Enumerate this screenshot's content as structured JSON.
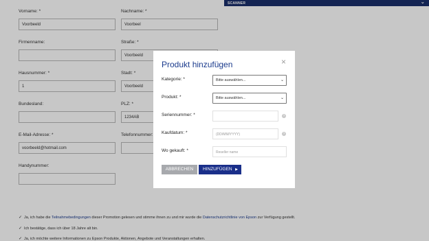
{
  "header": {
    "section_title": "SCANNER"
  },
  "form": {
    "vorname_label": "Vorname: *",
    "vorname_value": "Voorbeeld",
    "nachname_label": "Nachname: *",
    "nachname_value": "Voorbeel",
    "firmenname_label": "Firmenname:",
    "firmenname_value": "",
    "strasse_label": "Straße: *",
    "strasse_value": "Voorbeeld",
    "hausnummer_label": "Hausnummer: *",
    "hausnummer_value": "1",
    "stadt_label": "Stadt: *",
    "stadt_value": "Voorbeeld",
    "bundesland_label": "Bundesland:",
    "bundesland_value": "",
    "plz_label": "PLZ: *",
    "plz_value": "1234AB",
    "email_label": "E-Mail-Adresse: *",
    "email_value": "voorbeeld@hotmail.com",
    "telefon_label": "Telefonnummer:",
    "telefon_value": "",
    "handy_label": "Handynummer:",
    "handy_value": ""
  },
  "consent": {
    "item1_pre": "Ja, ich habe die ",
    "item1_link1": "Teilnahmebedingungen",
    "item1_mid": " dieser Promotion gelesen und stimme ihnen zu und mir wurde die ",
    "item1_link2": "Datenschutzrichtlinie von Epson",
    "item1_post": " zur Verfügung gestellt.",
    "item2": "Ich bestätige, dass ich über 18 Jahre alt bin.",
    "item3": "Ja, ich möchte weitere Informationen zu Epson Produkte, Aktionen, Angebote und Veranstaltungen erhalten."
  },
  "modal": {
    "title": "Produkt hinzufügen",
    "close_glyph": "×",
    "kategorie_label": "Kategorie: *",
    "kategorie_value": "Bitte auswählen...",
    "produkt_label": "Produkt: *",
    "produkt_value": "Bitte auswählen...",
    "serien_label": "Seriennummer: *",
    "serien_value": "",
    "kaufdatum_label": "Kaufdatum: *",
    "kaufdatum_placeholder": "(DD/MM/YYYY)",
    "gekauft_label": "Wo gekauft: *",
    "gekauft_placeholder": "Reseller name",
    "help_glyph": "?",
    "cancel_label": "ABBRECHEN",
    "add_label": "HINZUFÜGEN"
  },
  "colors": {
    "brand_navy": "#1a2f6b",
    "button_blue": "#1a2f8a",
    "title_blue": "#1a3a8c",
    "cancel_gray": "#a7a9ad"
  },
  "icons": {
    "scanner_expand": "chevron-down-icon",
    "modal_close": "close-icon",
    "help": "help-icon",
    "add_arrow": "play-arrow-icon",
    "consent_check": "checkmark-icon"
  }
}
